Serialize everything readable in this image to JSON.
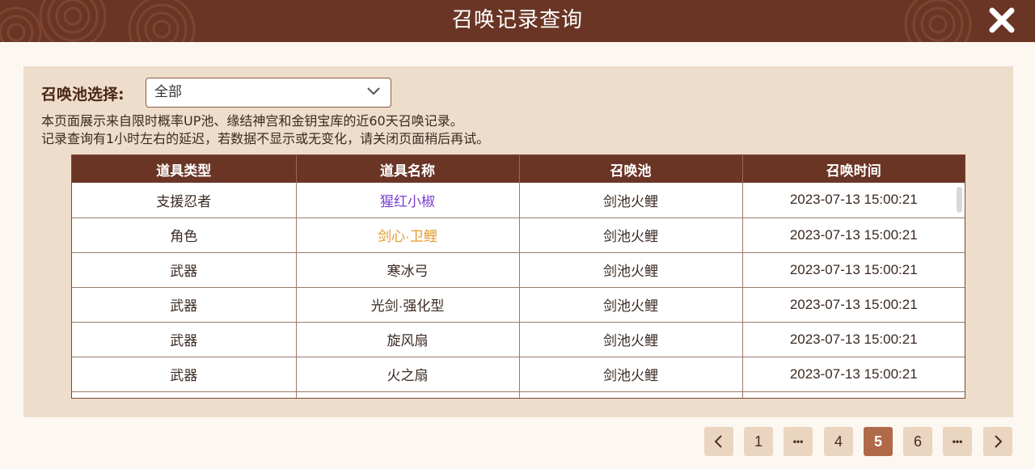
{
  "header": {
    "title": "召唤记录查询",
    "close_icon": "close-icon"
  },
  "filter": {
    "label": "召唤池选择:",
    "selected": "全部"
  },
  "description": {
    "line1": "本页面展示来自限时概率UP池、缘结神宫和金钥宝库的近60天召唤记录。",
    "line2": "记录查询有1小时左右的延迟，若数据不显示或无变化，请关闭页面稍后再试。"
  },
  "table": {
    "columns": [
      "道具类型",
      "道具名称",
      "召唤池",
      "召唤时间"
    ],
    "rows": [
      {
        "type": "支援忍者",
        "name": "猩红小椒",
        "pool": "剑池火鲤",
        "time": "2023-07-13 15:00:21"
      },
      {
        "type": "角色",
        "name": "剑心·卫鲤",
        "pool": "剑池火鲤",
        "time": "2023-07-13 15:00:21"
      },
      {
        "type": "武器",
        "name": "寒冰弓",
        "pool": "剑池火鲤",
        "time": "2023-07-13 15:00:21"
      },
      {
        "type": "武器",
        "name": "光剑·强化型",
        "pool": "剑池火鲤",
        "time": "2023-07-13 15:00:21"
      },
      {
        "type": "武器",
        "name": "旋风扇",
        "pool": "剑池火鲤",
        "time": "2023-07-13 15:00:21"
      },
      {
        "type": "武器",
        "name": "火之扇",
        "pool": "剑池火鲤",
        "time": "2023-07-13 15:00:21"
      }
    ]
  },
  "pagination": {
    "first": "1",
    "ellipsis": "•••",
    "prev_page": "4",
    "current": "5",
    "next_page": "6"
  },
  "colors": {
    "header_bg": "#6a3524",
    "panel_bg": "#eeddcb",
    "rare_purple": "#7a3fd0",
    "rare_orange": "#e49a2a",
    "active_page": "#b06a4a"
  }
}
